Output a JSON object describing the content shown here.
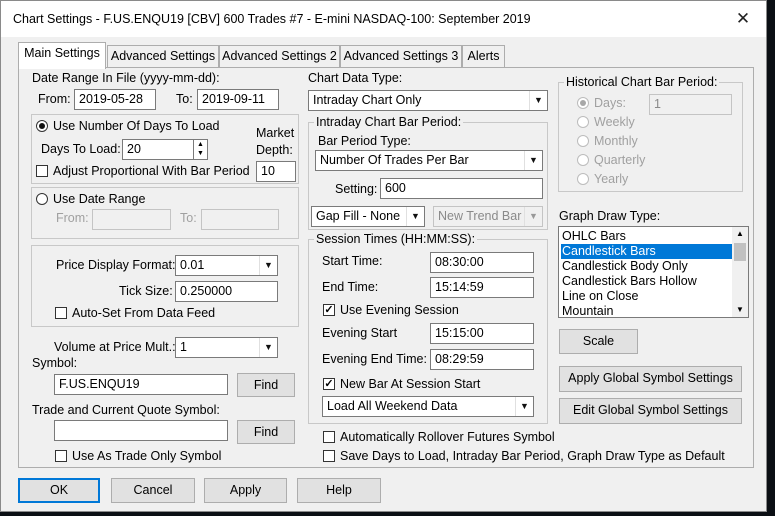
{
  "window": {
    "title": "Chart Settings - F.US.ENQU19 [CBV]  600 Trades  #7 - E-mini NASDAQ-100: September 2019"
  },
  "tabs": [
    "Main Settings",
    "Advanced Settings",
    "Advanced Settings 2",
    "Advanced Settings 3",
    "Alerts"
  ],
  "date_range": {
    "label": "Date Range In File (yyyy-mm-dd):",
    "from_label": "From:",
    "from": "2019-05-28",
    "to_label": "To:",
    "to": "2019-09-11",
    "use_days_label": "Use Number Of Days To Load",
    "days_label": "Days To Load:",
    "days": "20",
    "market_depth_label_1": "Market",
    "market_depth_label_2": "Depth:",
    "market_depth": "10",
    "adjust_label": "Adjust Proportional With Bar Period",
    "use_range_label": "Use Date Range",
    "range_from_label": "From:",
    "range_to_label": "To:"
  },
  "price": {
    "format_label": "Price Display Format:",
    "format": "0.01",
    "tick_label": "Tick Size:",
    "tick": "0.250000",
    "auto_set_label": "Auto-Set From Data Feed"
  },
  "volume": {
    "label": "Volume at Price Mult.:",
    "value": "1"
  },
  "symbol": {
    "label": "Symbol:",
    "value": "F.US.ENQU19",
    "find": "Find"
  },
  "trade_symbol": {
    "label": "Trade and Current Quote Symbol:",
    "value": "",
    "find": "Find",
    "trade_only_label": "Use As Trade Only Symbol"
  },
  "chart_data_type": {
    "label": "Chart Data Type:",
    "value": "Intraday Chart Only"
  },
  "intraday": {
    "group_label": "Intraday Chart Bar Period:",
    "bar_type_label": "Bar Period Type:",
    "bar_type": "Number Of Trades Per Bar",
    "setting_label": "Setting:",
    "setting": "600",
    "gap_fill": "Gap Fill - None",
    "new_trend": "New Trend Bar W"
  },
  "session": {
    "group_label": "Session Times (HH:MM:SS):",
    "start_label": "Start Time:",
    "start": "08:30:00",
    "end_label": "End Time:",
    "end": "15:14:59",
    "evening_label": "Use Evening Session",
    "evening_start_label": "Evening Start",
    "evening_start": "15:15:00",
    "evening_end_label": "Evening End Time:",
    "evening_end": "08:29:59",
    "new_bar_label": "New Bar At Session Start",
    "weekend": "Load All Weekend Data"
  },
  "rollover_label": "Automatically Rollover Futures Symbol",
  "save_default_label": "Save Days to Load, Intraday Bar Period, Graph Draw Type as Default",
  "historical": {
    "group_label": "Historical Chart Bar Period:",
    "options": [
      "Days:",
      "Weekly",
      "Monthly",
      "Quarterly",
      "Yearly"
    ],
    "days_value": "1"
  },
  "graph_draw": {
    "label": "Graph Draw Type:",
    "items": [
      "OHLC Bars",
      "Candlestick Bars",
      "Candlestick Body Only",
      "Candlestick Bars Hollow",
      "Line on Close",
      "Mountain"
    ],
    "selected": "Candlestick Bars"
  },
  "buttons": {
    "scale": "Scale",
    "apply_global": "Apply Global Symbol Settings",
    "edit_global": "Edit Global Symbol Settings",
    "ok": "OK",
    "cancel": "Cancel",
    "apply": "Apply",
    "help": "Help"
  },
  "colors": {
    "selection": "#0078d7",
    "background": "#f0f0f0"
  }
}
